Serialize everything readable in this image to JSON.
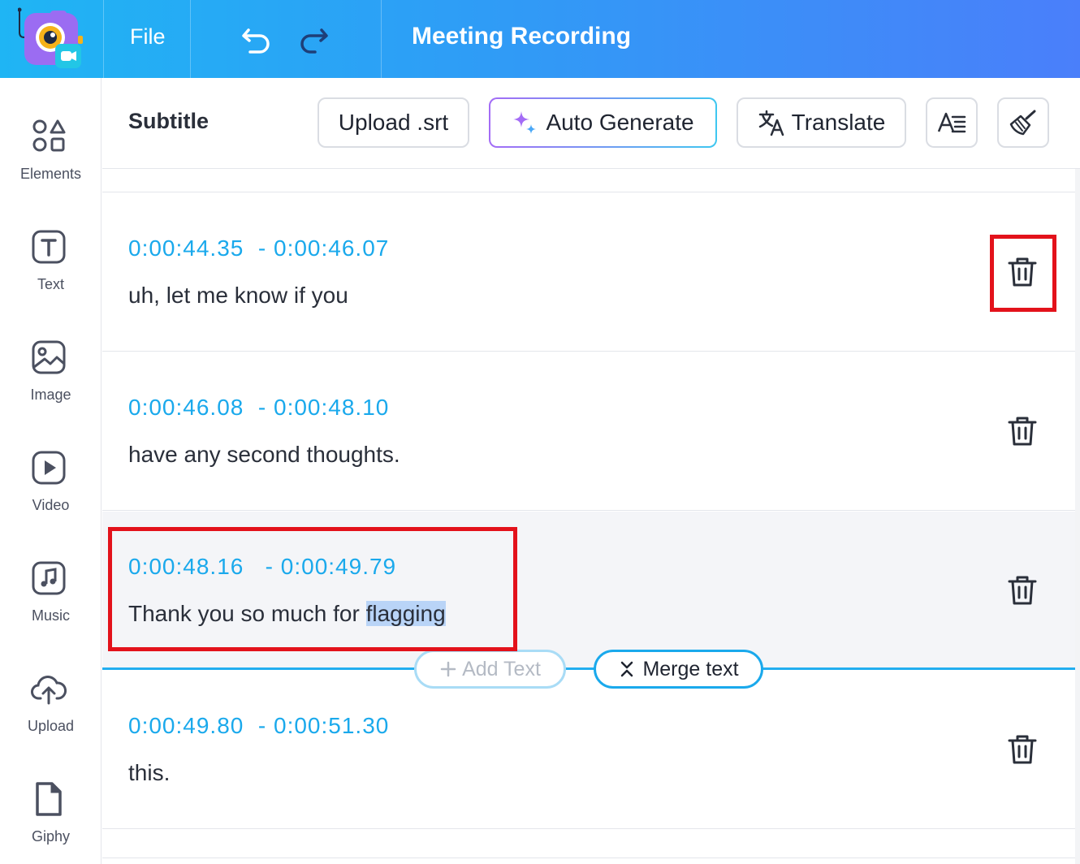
{
  "header": {
    "file_label": "File",
    "title": "Meeting Recording",
    "undo_icon": "undo-arrow-icon",
    "redo_icon": "redo-arrow-icon",
    "logo_icon": "camera-app-logo-icon",
    "colors": {
      "gradient_start": "#1fb5f4",
      "gradient_end": "#4a7ffa"
    }
  },
  "sidebar": {
    "items": [
      {
        "label": "Elements",
        "icon": "shapes-icon"
      },
      {
        "label": "Text",
        "icon": "text-box-icon"
      },
      {
        "label": "Image",
        "icon": "image-icon"
      },
      {
        "label": "Video",
        "icon": "play-icon"
      },
      {
        "label": "Music",
        "icon": "music-note-icon"
      },
      {
        "label": "Upload",
        "icon": "cloud-upload-icon"
      },
      {
        "label": "Giphy",
        "icon": "file-icon"
      }
    ]
  },
  "toolbar": {
    "title": "Subtitle",
    "upload_label": "Upload .srt",
    "auto_label": "Auto Generate",
    "translate_label": "Translate",
    "style_icon": "text-style-icon",
    "clean_icon": "broom-icon"
  },
  "subtitles": [
    {
      "time": "0:00:44.35  - 0:00:46.07",
      "text": "uh, let me know if you"
    },
    {
      "time": "0:00:46.08  - 0:00:48.10",
      "text": "have any second thoughts."
    },
    {
      "time": "0:00:48.16   - 0:00:49.79",
      "text_before": "Thank you so much for ",
      "text_highlight": "flagging"
    },
    {
      "time": "0:00:49.80  - 0:00:51.30",
      "text": "this."
    }
  ],
  "insert_bar": {
    "add_text_label": "Add Text",
    "merge_label": "Merge text"
  },
  "colors": {
    "accent": "#1aa9ec",
    "annotation": "#e3121b",
    "highlight": "#b9d4f7"
  }
}
